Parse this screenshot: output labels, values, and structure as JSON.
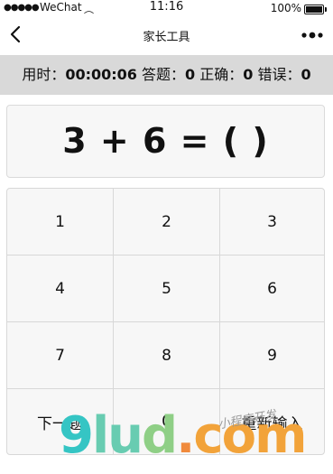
{
  "status_bar": {
    "signal": "●●●●●",
    "carrier": "WeChat",
    "wifi": "︵",
    "time": "11:16",
    "battery": "100%"
  },
  "nav": {
    "title": "家长工具"
  },
  "stats": {
    "time_label": "用时：",
    "time_value": "00:00:06",
    "answered_label": "答题：",
    "answered_value": "0",
    "correct_label": "正确：",
    "correct_value": "0",
    "wrong_label": "错误：",
    "wrong_value": "0"
  },
  "question": {
    "text": "3 + 6 = ( )"
  },
  "keypad": {
    "keys": [
      "1",
      "2",
      "3",
      "4",
      "5",
      "6",
      "7",
      "8",
      "9",
      "下一题",
      "0",
      "重新输入"
    ]
  },
  "watermark": {
    "main_a": "9",
    "main_b": "lu",
    "main_c": "d",
    "dot": ".",
    "com": "com",
    "small": "小程序开发"
  }
}
